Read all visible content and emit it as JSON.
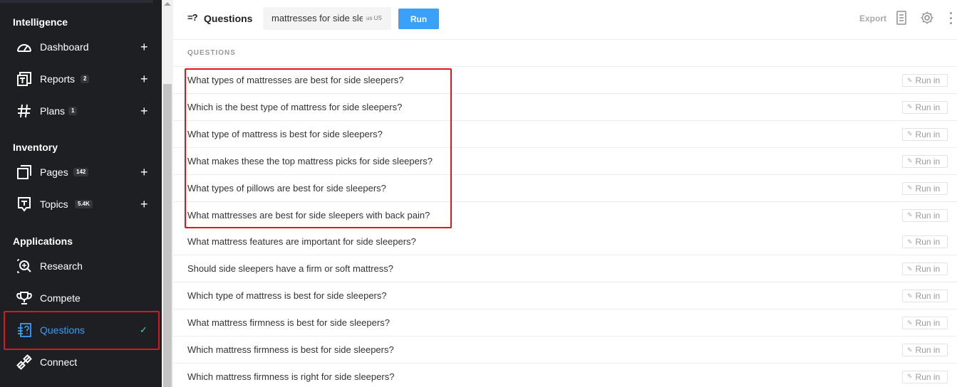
{
  "sidebar": {
    "sections": {
      "intelligence": "Intelligence",
      "inventory": "Inventory",
      "applications": "Applications"
    },
    "items": {
      "dashboard": {
        "label": "Dashboard",
        "icon": "gauge-icon"
      },
      "reports": {
        "label": "Reports",
        "badge": "2",
        "icon": "reports-icon"
      },
      "plans": {
        "label": "Plans",
        "badge": "1",
        "icon": "hash-icon"
      },
      "pages": {
        "label": "Pages",
        "badge": "142",
        "icon": "pages-icon"
      },
      "topics": {
        "label": "Topics",
        "badge": "5.4K",
        "icon": "topic-icon"
      },
      "research": {
        "label": "Research",
        "icon": "research-icon"
      },
      "compete": {
        "label": "Compete",
        "icon": "trophy-icon"
      },
      "questions": {
        "label": "Questions",
        "icon": "questions-icon",
        "active": true
      },
      "connect": {
        "label": "Connect",
        "icon": "connect-icon"
      }
    },
    "plus": "+",
    "check": "✓"
  },
  "header": {
    "icon_glyph": "=?",
    "title": "Questions",
    "search_value": "mattresses for side sleepers",
    "location": "us US",
    "run_label": "Run",
    "export_label": "Export"
  },
  "list": {
    "header": "QUESTIONS",
    "run_in_label": "Run in",
    "questions": [
      "What types of mattresses are best for side sleepers?",
      "Which is the best type of mattress for side sleepers?",
      "What type of mattress is best for side sleepers?",
      "What makes these the top mattress picks for side sleepers?",
      "What types of pillows are best for side sleepers?",
      "What mattresses are best for side sleepers with back pain?",
      "What mattress features are important for side sleepers?",
      "Should side sleepers have a firm or soft mattress?",
      "Which type of mattress is best for side sleepers?",
      "What mattress firmness is best for side sleepers?",
      "Which mattress firmness is best for side sleepers?",
      "Which mattress firmness is right for side sleepers?"
    ]
  },
  "colors": {
    "sidebar_bg": "#1d1f23",
    "accent": "#3aa0f8",
    "highlight": "#e0161c",
    "check": "#4fd1a5"
  }
}
